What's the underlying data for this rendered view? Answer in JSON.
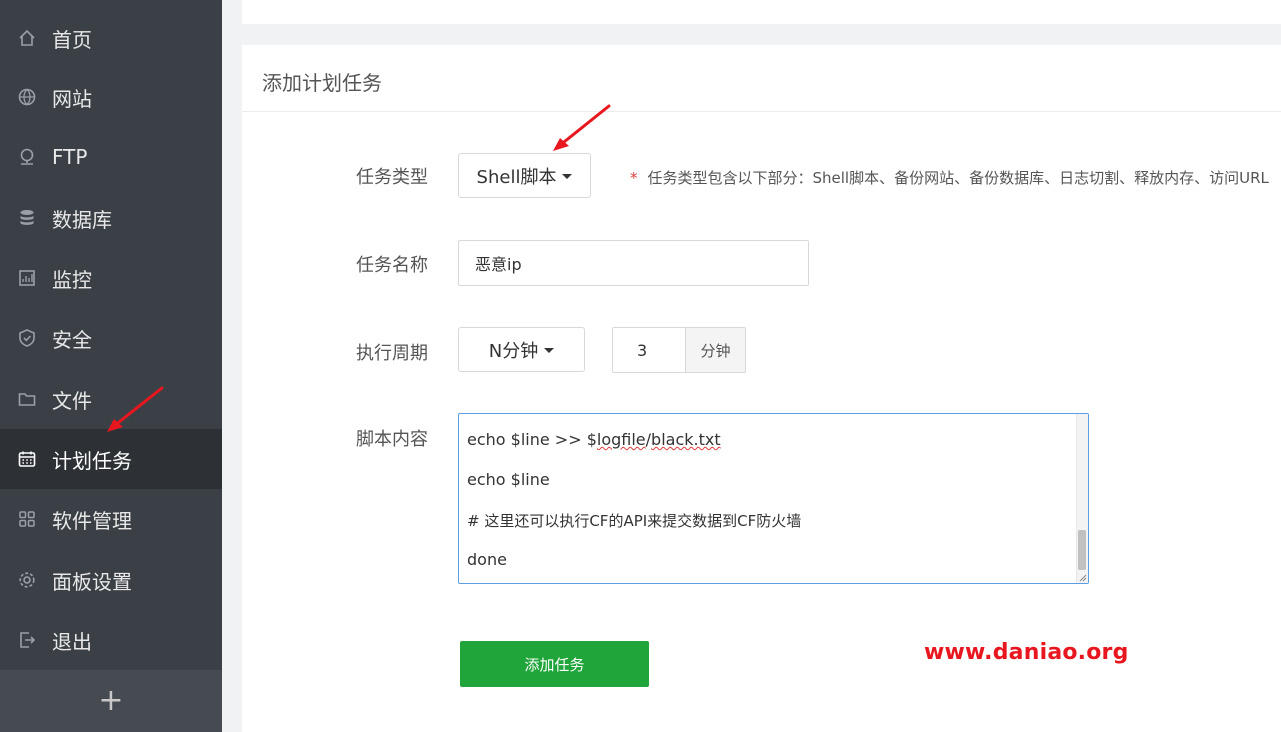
{
  "sidebar": {
    "items": [
      {
        "label": "首页",
        "icon": "home-icon"
      },
      {
        "label": "网站",
        "icon": "globe-icon"
      },
      {
        "label": "FTP",
        "icon": "network-icon"
      },
      {
        "label": "数据库",
        "icon": "database-icon"
      },
      {
        "label": "监控",
        "icon": "monitor-icon"
      },
      {
        "label": "安全",
        "icon": "shield-icon"
      },
      {
        "label": "文件",
        "icon": "folder-icon"
      },
      {
        "label": "计划任务",
        "icon": "calendar-icon",
        "active": true
      },
      {
        "label": "软件管理",
        "icon": "grid-icon"
      },
      {
        "label": "面板设置",
        "icon": "gear-icon"
      },
      {
        "label": "退出",
        "icon": "logout-icon"
      }
    ],
    "add_label": "+"
  },
  "card": {
    "title": "添加计划任务"
  },
  "form": {
    "task_type": {
      "label": "任务类型",
      "value": "Shell脚本",
      "hint_star": "*",
      "hint": "任务类型包含以下部分：Shell脚本、备份网站、备份数据库、日志切割、释放内存、访问URL"
    },
    "task_name": {
      "label": "任务名称",
      "value": "恶意ip"
    },
    "cycle": {
      "label": "执行周期",
      "value": "N分钟",
      "minutes": "3",
      "unit": "分钟"
    },
    "script": {
      "label": "脚本内容",
      "lines": {
        "l1_pre": "echo $line >> $",
        "l1_sq1": "logfile",
        "l1_mid": "/",
        "l1_sq2": "black.txt",
        "l2": "echo $line",
        "l3": "# 这里还可以执行CF的API来提交数据到CF防火墙",
        "l4": "done"
      }
    },
    "submit_label": "添加任务"
  },
  "watermark": "www.daniao.org",
  "colors": {
    "sidebar_bg": "#3b4046",
    "sidebar_active": "#2d3136",
    "primary_green": "#20a53a",
    "focus_blue": "#5b9ee4",
    "annotation_red": "#e8161e"
  }
}
